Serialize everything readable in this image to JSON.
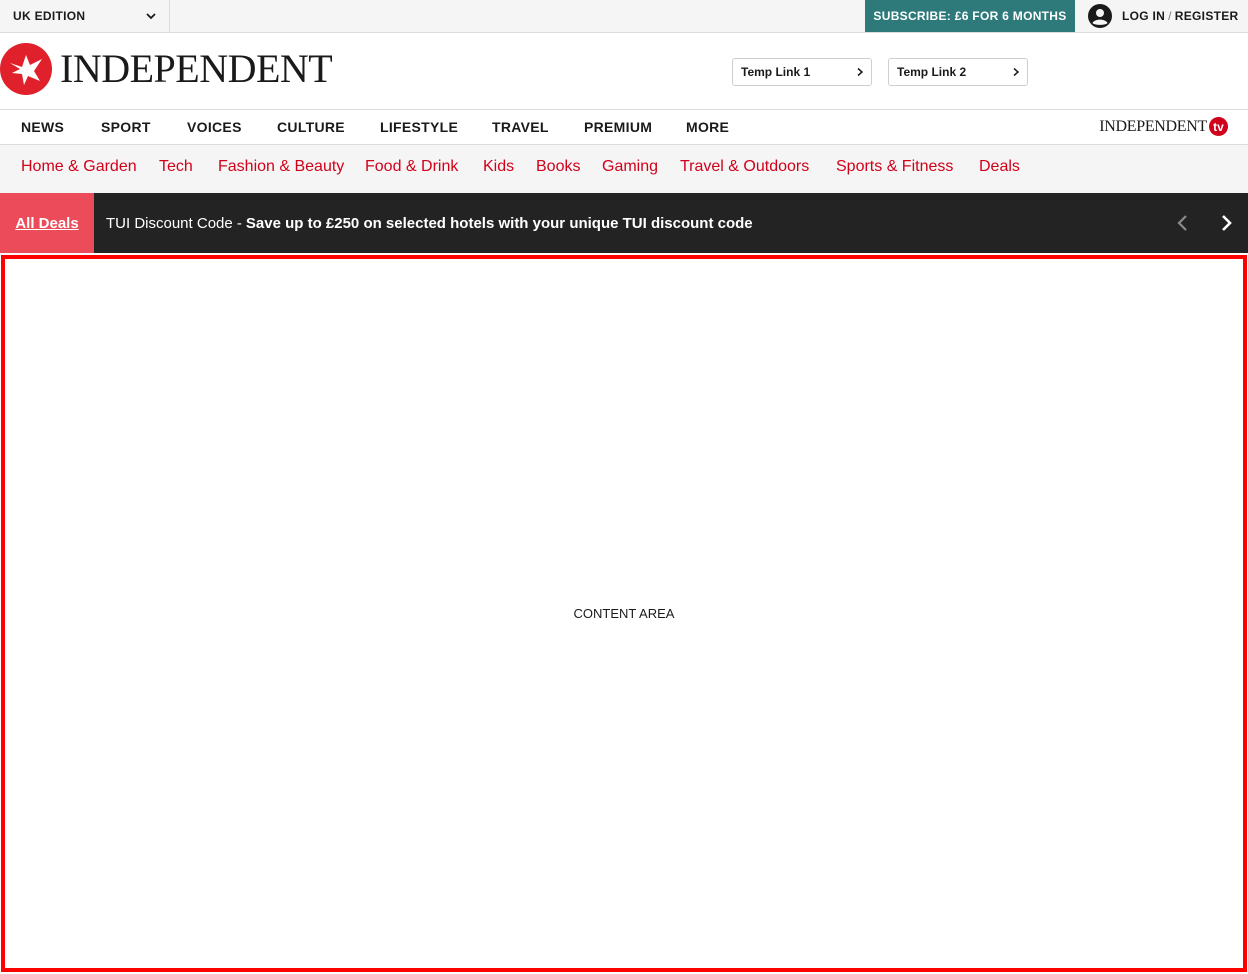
{
  "topbar": {
    "edition_label": "UK EDITION",
    "subscribe_label": "SUBSCRIBE: £6 FOR 6 MONTHS",
    "login_label": "LOG IN",
    "register_label": "REGISTER"
  },
  "masthead": {
    "logo_text": "INDEPENDENT",
    "temp_links": [
      "Temp Link 1",
      "Temp Link 2"
    ]
  },
  "main_nav": {
    "items": [
      "NEWS",
      "SPORT",
      "VOICES",
      "CULTURE",
      "LIFESTYLE",
      "TRAVEL",
      "PREMIUM",
      "MORE"
    ],
    "tv_logo_text": "INDEPENDENT",
    "tv_badge": "tv"
  },
  "sub_nav": {
    "items": [
      "Home & Garden",
      "Tech",
      "Fashion & Beauty",
      "Food & Drink",
      "Kids",
      "Books",
      "Gaming",
      "Travel & Outdoors",
      "Sports & Fitness",
      "Deals"
    ]
  },
  "deals_bar": {
    "all_deals_label": "All Deals",
    "deal_title": "TUI Discount Code -",
    "deal_description": "Save up to £250 on selected hotels with your unique TUI discount code"
  },
  "content": {
    "placeholder": "CONTENT AREA"
  },
  "colors": {
    "brand_red": "#d0021b",
    "subscribe_teal": "#2e7a7b",
    "deals_pink": "#ec4b5a",
    "deals_bg": "#232323",
    "content_border": "#ff0000"
  }
}
